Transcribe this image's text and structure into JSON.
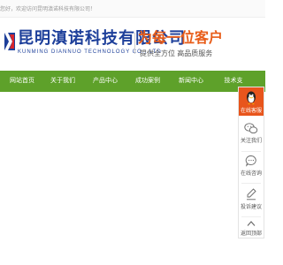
{
  "topbar": {
    "welcome": "您好，欢迎访问昆明滇诺科技有限公司！"
  },
  "header": {
    "company_cn": "昆明滇诺科技有限公司",
    "company_en": "KUNMING DIANNUO  TECHNOLOGY CO., LTD",
    "slogan": "为每一位客户",
    "subslogan": "提供全方位  高品质服务",
    "colors": {
      "brand_blue": "#1d3f9a",
      "slogan_orange": "#e85d19"
    }
  },
  "nav": {
    "color": "#5ea12a",
    "items": [
      {
        "label": "网站首页"
      },
      {
        "label": "关于我们"
      },
      {
        "label": "产品中心"
      },
      {
        "label": "成功案例"
      },
      {
        "label": "新闻中心"
      },
      {
        "label": "技术支"
      }
    ]
  },
  "side_toolbar": {
    "accent": "#e8551c",
    "items": [
      {
        "label": "在线客服",
        "icon": "qq-penguin-icon"
      },
      {
        "label": "关注我们",
        "icon": "wechat-icon"
      },
      {
        "label": "在线咨询",
        "icon": "chat-bubble-icon"
      },
      {
        "label": "投诉建议",
        "icon": "pencil-icon"
      },
      {
        "label": "返回顶部",
        "icon": "arrow-up-icon"
      }
    ]
  }
}
